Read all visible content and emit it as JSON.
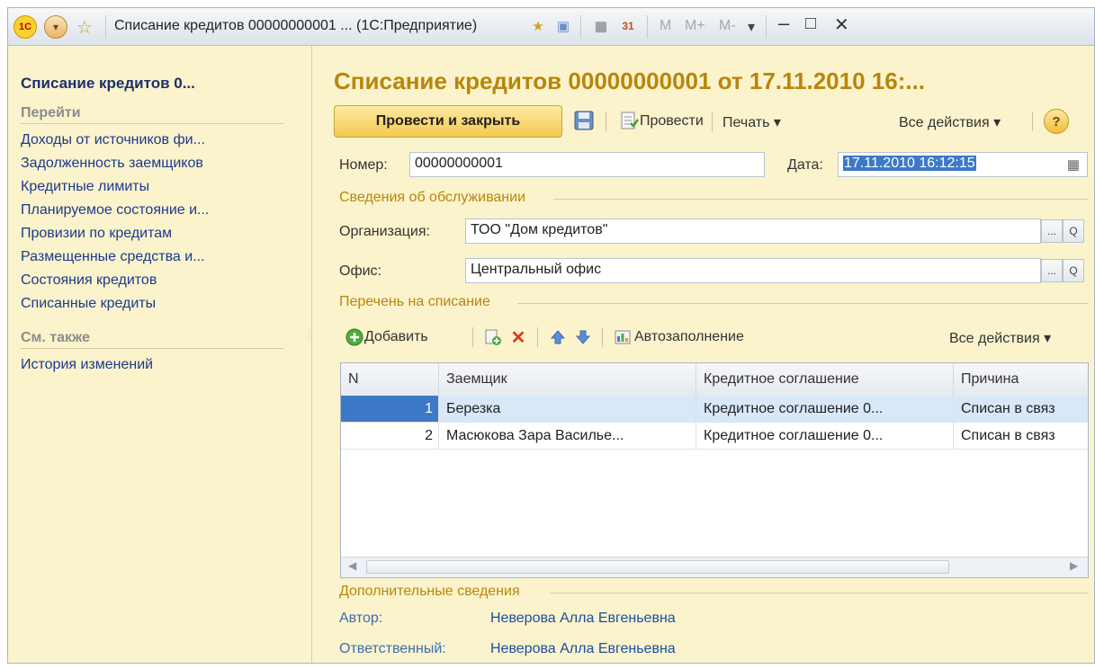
{
  "titlebar": {
    "logo": "1С",
    "title": "Списание кредитов 00000000001 ... (1С:Предприятие)",
    "m_buttons": [
      "M",
      "M+",
      "M-"
    ],
    "icons": [
      "star-icon",
      "bookmark-icon",
      "calculator-icon",
      "calendar-icon"
    ]
  },
  "sidebar": {
    "title": "Списание кредитов 0...",
    "goto_header": "Перейти",
    "goto_items": [
      "Доходы от источников фи...",
      "Задолженность заемщиков",
      "Кредитные лимиты",
      "Планируемое состояние и...",
      "Провизии по кредитам",
      "Размещенные средства и...",
      "Состояния кредитов",
      "Списанные кредиты"
    ],
    "see_also_header": "См. также",
    "see_also_items": [
      "История изменений"
    ]
  },
  "main": {
    "title": "Списание кредитов 00000000001 от 17.11.2010 16:...",
    "toolbar": {
      "post_close": "Провести и закрыть",
      "post": "Провести",
      "print": "Печать ▾",
      "all_actions": "Все действия ▾",
      "help": "?"
    },
    "number_label": "Номер:",
    "number_value": "00000000001",
    "date_label": "Дата:",
    "date_value": "17.11.2010 16:12:15",
    "service_group": "Сведения об обслуживании",
    "org_label": "Организация:",
    "org_value": "ТОО \"Дом кредитов\"",
    "office_label": "Офис:",
    "office_value": "Центральный офис",
    "list_group": "Перечень на списание",
    "table_toolbar": {
      "add": "Добавить",
      "autofill": "Автозаполнение",
      "all_actions": "Все действия ▾"
    },
    "table": {
      "columns": [
        "N",
        "Заемщик",
        "Кредитное соглашение",
        "Причина"
      ],
      "rows": [
        {
          "n": "1",
          "borrower": "Березка",
          "agreement": "Кредитное соглашение 0...",
          "reason": "Списан в связ"
        },
        {
          "n": "2",
          "borrower": "Масюкова Зара Василье...",
          "agreement": "Кредитное соглашение 0...",
          "reason": "Списан в связ"
        }
      ]
    },
    "extra_group": "Дополнительные сведения",
    "author_label": "Автор:",
    "author_value": "Неверова Алла Евгеньевна",
    "responsible_label": "Ответственный:",
    "responsible_value": "Неверова Алла Евгеньевна",
    "select_button": "...",
    "open_button": "Q"
  }
}
